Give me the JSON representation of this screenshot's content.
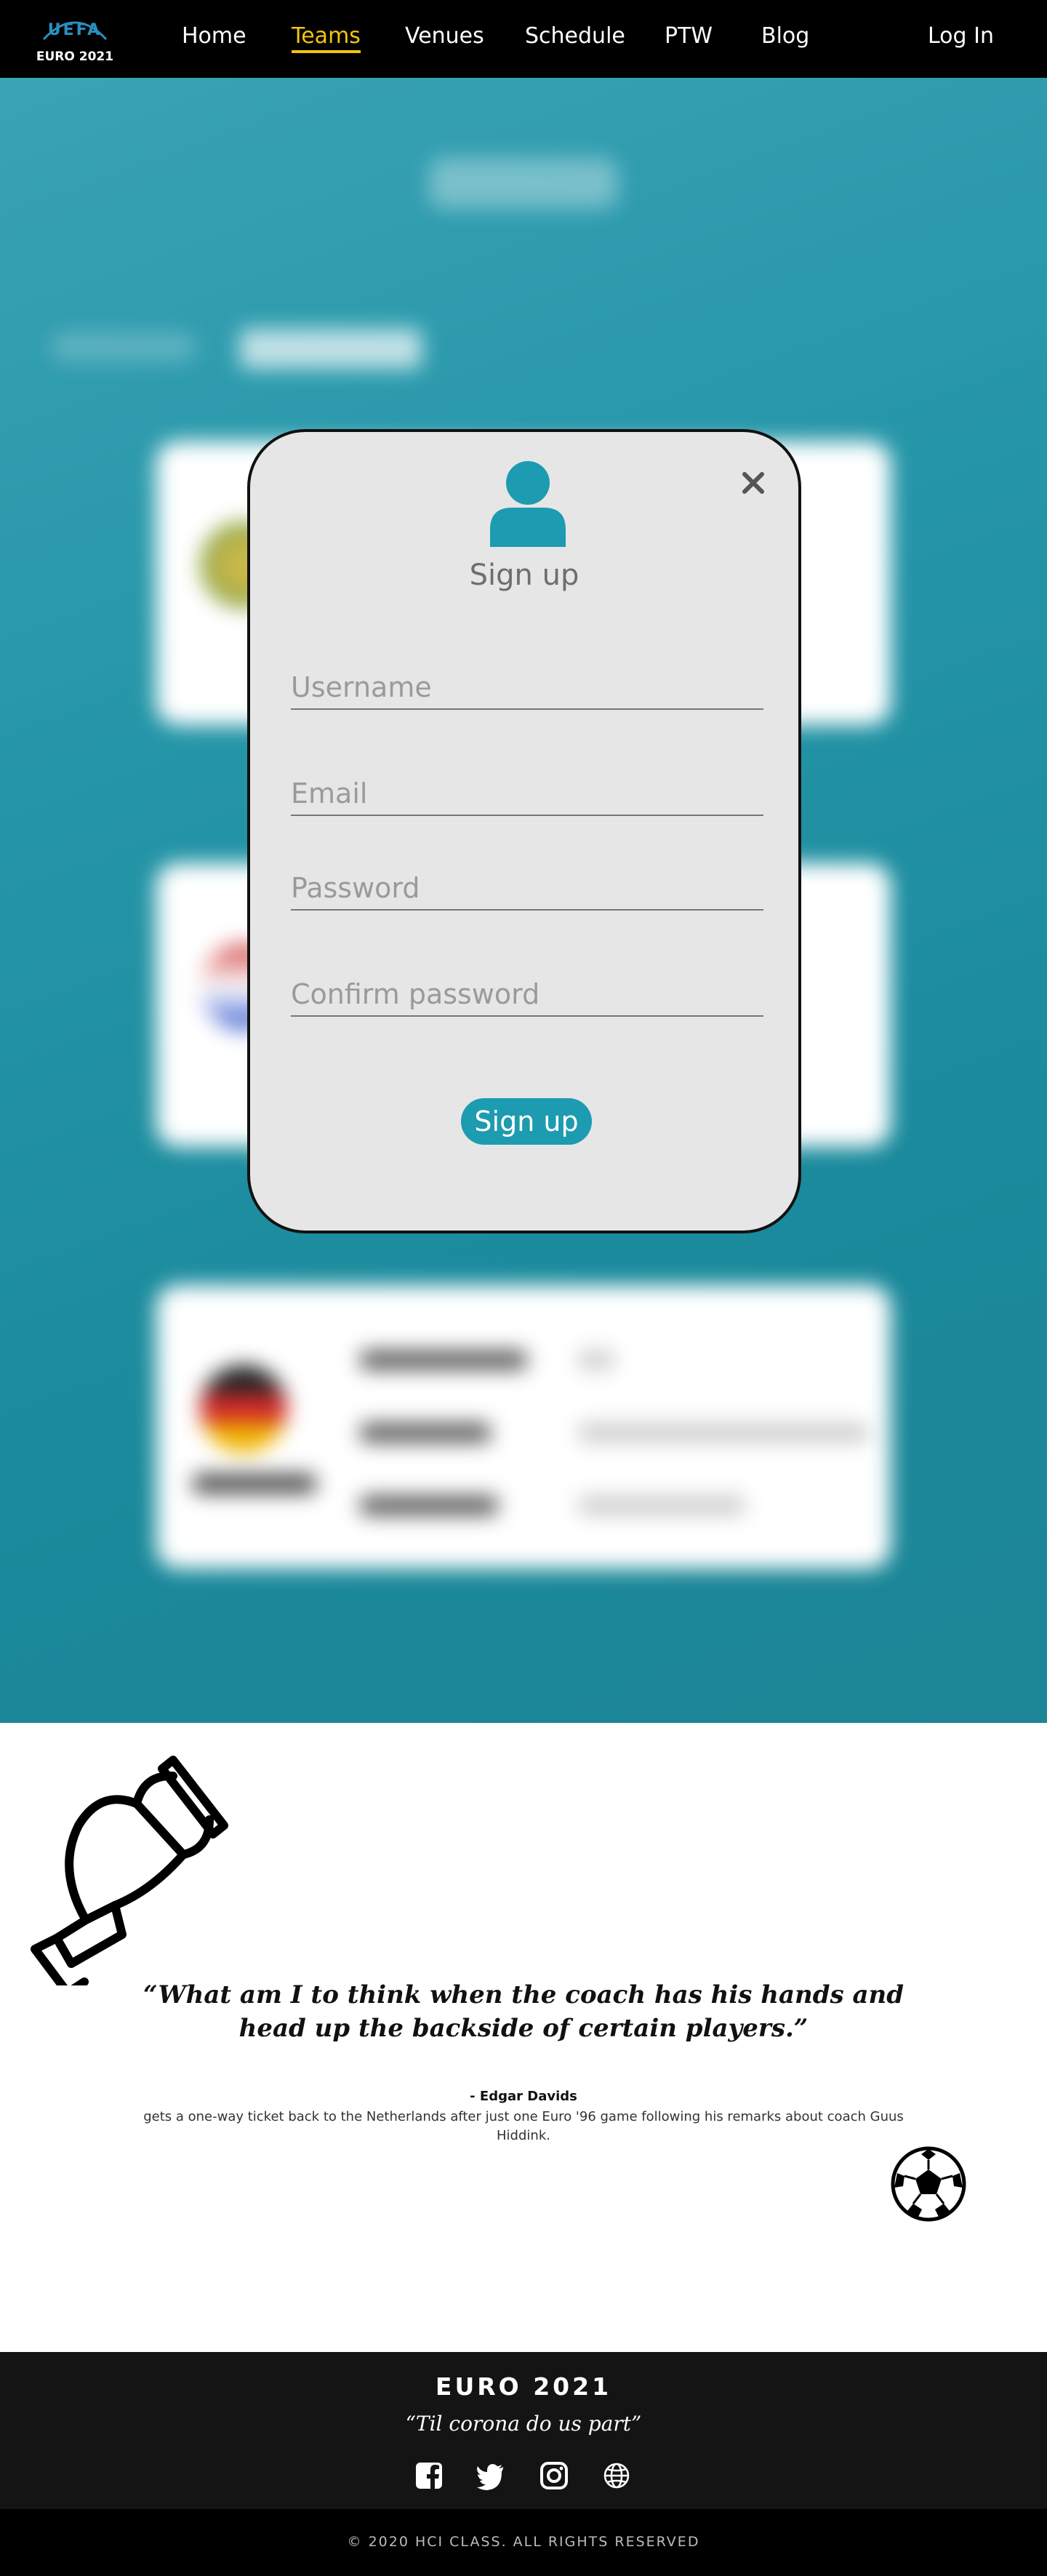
{
  "nav": {
    "logo_top": "UEFA",
    "logo_bottom": "EURO 2021",
    "links": [
      {
        "label": "Home"
      },
      {
        "label": "Teams",
        "active": true
      },
      {
        "label": "Venues"
      },
      {
        "label": "Schedule"
      },
      {
        "label": "PTW"
      },
      {
        "label": "Blog"
      }
    ],
    "login": "Log In",
    "active_color": "#f1c40f"
  },
  "modal": {
    "title": "Sign up",
    "fields": {
      "username": "Username",
      "email": "Email",
      "password": "Password",
      "confirm": "Confirm password"
    },
    "submit": "Sign up",
    "accent_color": "#1d9bb0",
    "close_icon": "close-icon",
    "user_icon": "user-icon"
  },
  "quote": {
    "text": "“What am I to think when the coach has his hands and head up the backside of certain players.”",
    "author": "- Edgar Davids",
    "context": "gets a one-way ticket back to the Netherlands after just one Euro '96 game following his remarks about coach Guus Hiddink."
  },
  "footer": {
    "title": "EURO 2021",
    "motto": "“Til corona do us part”",
    "social_icons": [
      "facebook-icon",
      "twitter-icon",
      "instagram-icon",
      "globe-icon"
    ],
    "copyright": "© 2020 HCI CLASS. ALL RIGHTS RESERVED"
  }
}
